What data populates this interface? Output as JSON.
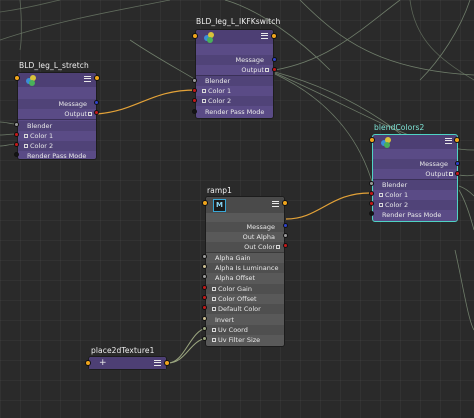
{
  "colors": {
    "canvas": "#2a2a2a",
    "node_purple": "#5a4b86",
    "node_grey": "#595959",
    "selection": "#4fd3c4",
    "wire_gray": "#6f7d6a",
    "wire_orange": "#e3a238",
    "port_orange": "#f0a51c",
    "port_blue": "#2e43c9",
    "port_red": "#c51919",
    "port_dark": "#141414",
    "port_gray": "#9a9a9a",
    "port_olive": "#9aa57f",
    "port_khaki": "#cbbf93"
  },
  "nodes": {
    "stretch": {
      "title": "BLD_leg_L_stretch",
      "icons": [
        "color-swatch-icon",
        "menu-icon"
      ],
      "outputs": [
        "Message",
        "Output"
      ],
      "inputs": [
        "Blender",
        "Color 1",
        "Color 2",
        "Render Pass Mode"
      ]
    },
    "ikfk": {
      "title": "BLD_leg_L_IKFKswitch",
      "icons": [
        "color-swatch-icon",
        "menu-icon"
      ],
      "outputs": [
        "Message",
        "Output"
      ],
      "inputs": [
        "Blender",
        "Color 1",
        "Color 2",
        "Render Pass Mode"
      ]
    },
    "blend2": {
      "title": "blendColors2",
      "icons": [
        "color-swatch-icon",
        "menu-icon"
      ],
      "outputs": [
        "Message",
        "Output"
      ],
      "inputs": [
        "Blender",
        "Color 1",
        "Color 2",
        "Render Pass Mode"
      ]
    },
    "ramp": {
      "title": "ramp1",
      "icons": [
        "maya-m-icon",
        "menu-icon"
      ],
      "outputs": [
        "Message",
        "Out Alpha",
        "Out Color"
      ],
      "inputs": [
        "Alpha Gain",
        "Alpha Is Luminance",
        "Alpha Offset",
        "Color Gain",
        "Color Offset",
        "Default Color",
        "Invert",
        "Uv Coord",
        "Uv Filter Size"
      ]
    },
    "place2d": {
      "title": "place2dTexture1",
      "icons": [
        "add-icon",
        "menu-icon"
      ]
    }
  }
}
